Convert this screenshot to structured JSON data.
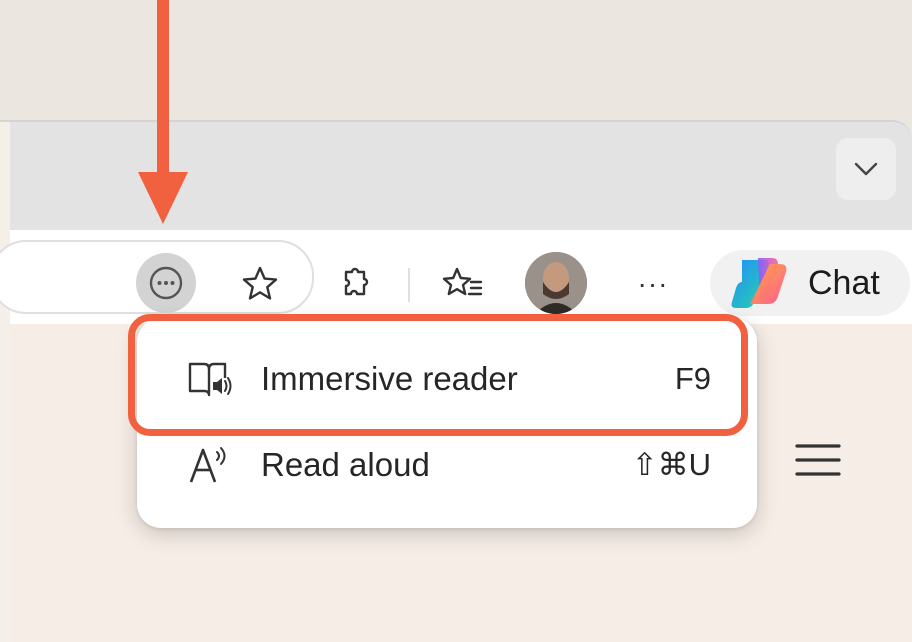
{
  "toolbar": {
    "more_label": "···",
    "chat_label": "Chat"
  },
  "menu": {
    "items": [
      {
        "label": "Immersive reader",
        "shortcut": "F9",
        "icon": "immersive-reader-icon"
      },
      {
        "label": "Read aloud",
        "shortcut": "⇧⌘U",
        "icon": "read-aloud-icon"
      }
    ]
  },
  "colors": {
    "annotation": "#f2613f",
    "page_background": "#ebe6df"
  }
}
